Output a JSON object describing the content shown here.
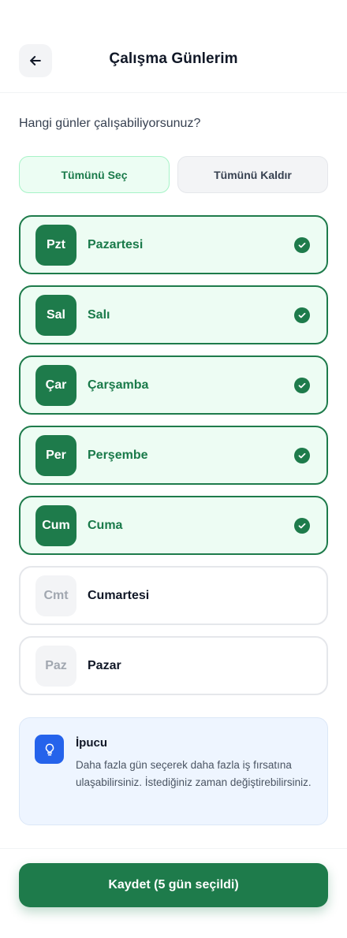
{
  "header": {
    "title": "Çalışma Günlerim",
    "back_icon": "arrow-left-icon"
  },
  "question": "Hangi günler çalışabiliyorsunuz?",
  "bulk": {
    "select_all": "Tümünü Seç",
    "clear_all": "Tümünü Kaldır"
  },
  "days": [
    {
      "abbr": "Pzt",
      "name": "Pazartesi",
      "selected": true
    },
    {
      "abbr": "Sal",
      "name": "Salı",
      "selected": true
    },
    {
      "abbr": "Çar",
      "name": "Çarşamba",
      "selected": true
    },
    {
      "abbr": "Per",
      "name": "Perşembe",
      "selected": true
    },
    {
      "abbr": "Cum",
      "name": "Cuma",
      "selected": true
    },
    {
      "abbr": "Cmt",
      "name": "Cumartesi",
      "selected": false
    },
    {
      "abbr": "Paz",
      "name": "Pazar",
      "selected": false
    }
  ],
  "tip": {
    "icon": "lightbulb-icon",
    "title": "İpucu",
    "text": "Daha fazla gün seçerek daha fazla iş fırsatına ulaşabilirsiniz. İstediğiniz zaman değiştirebilirsiniz."
  },
  "footer": {
    "save_label": "Kaydet (5 gün seçildi)"
  },
  "colors": {
    "primary": "#1e7b4b",
    "selected_bg": "#edfcf3",
    "tip_bg": "#eef5ff",
    "tip_icon": "#2563eb"
  }
}
